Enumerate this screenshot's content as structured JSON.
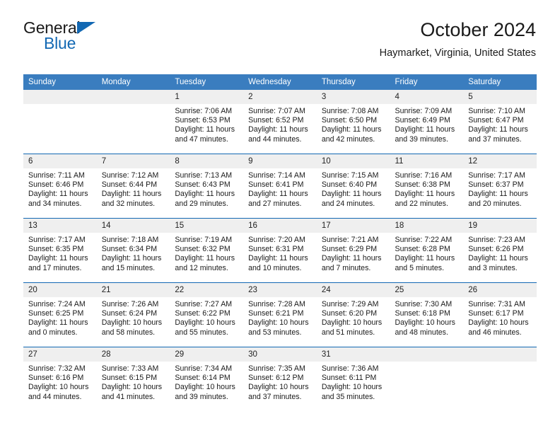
{
  "brand": {
    "name_part1": "General",
    "name_part2": "Blue",
    "triangle_icon": "triangle-icon",
    "colors": {
      "blue": "#1268b3",
      "header_blue": "#3a7dbf",
      "daynum_band": "#efefef"
    }
  },
  "header": {
    "title": "October 2024",
    "subtitle": "Haymarket, Virginia, United States"
  },
  "weekdays": [
    "Sunday",
    "Monday",
    "Tuesday",
    "Wednesday",
    "Thursday",
    "Friday",
    "Saturday"
  ],
  "labels": {
    "sunrise_prefix": "Sunrise:",
    "sunset_prefix": "Sunset:",
    "daylight_prefix": "Daylight:"
  },
  "weeks": [
    [
      {
        "day": "",
        "empty": true
      },
      {
        "day": "",
        "empty": true
      },
      {
        "day": "1",
        "sunrise": "Sunrise: 7:06 AM",
        "sunset": "Sunset: 6:53 PM",
        "daylight_line1": "Daylight: 11 hours",
        "daylight_line2": "and 47 minutes."
      },
      {
        "day": "2",
        "sunrise": "Sunrise: 7:07 AM",
        "sunset": "Sunset: 6:52 PM",
        "daylight_line1": "Daylight: 11 hours",
        "daylight_line2": "and 44 minutes."
      },
      {
        "day": "3",
        "sunrise": "Sunrise: 7:08 AM",
        "sunset": "Sunset: 6:50 PM",
        "daylight_line1": "Daylight: 11 hours",
        "daylight_line2": "and 42 minutes."
      },
      {
        "day": "4",
        "sunrise": "Sunrise: 7:09 AM",
        "sunset": "Sunset: 6:49 PM",
        "daylight_line1": "Daylight: 11 hours",
        "daylight_line2": "and 39 minutes."
      },
      {
        "day": "5",
        "sunrise": "Sunrise: 7:10 AM",
        "sunset": "Sunset: 6:47 PM",
        "daylight_line1": "Daylight: 11 hours",
        "daylight_line2": "and 37 minutes."
      }
    ],
    [
      {
        "day": "6",
        "sunrise": "Sunrise: 7:11 AM",
        "sunset": "Sunset: 6:46 PM",
        "daylight_line1": "Daylight: 11 hours",
        "daylight_line2": "and 34 minutes."
      },
      {
        "day": "7",
        "sunrise": "Sunrise: 7:12 AM",
        "sunset": "Sunset: 6:44 PM",
        "daylight_line1": "Daylight: 11 hours",
        "daylight_line2": "and 32 minutes."
      },
      {
        "day": "8",
        "sunrise": "Sunrise: 7:13 AM",
        "sunset": "Sunset: 6:43 PM",
        "daylight_line1": "Daylight: 11 hours",
        "daylight_line2": "and 29 minutes."
      },
      {
        "day": "9",
        "sunrise": "Sunrise: 7:14 AM",
        "sunset": "Sunset: 6:41 PM",
        "daylight_line1": "Daylight: 11 hours",
        "daylight_line2": "and 27 minutes."
      },
      {
        "day": "10",
        "sunrise": "Sunrise: 7:15 AM",
        "sunset": "Sunset: 6:40 PM",
        "daylight_line1": "Daylight: 11 hours",
        "daylight_line2": "and 24 minutes."
      },
      {
        "day": "11",
        "sunrise": "Sunrise: 7:16 AM",
        "sunset": "Sunset: 6:38 PM",
        "daylight_line1": "Daylight: 11 hours",
        "daylight_line2": "and 22 minutes."
      },
      {
        "day": "12",
        "sunrise": "Sunrise: 7:17 AM",
        "sunset": "Sunset: 6:37 PM",
        "daylight_line1": "Daylight: 11 hours",
        "daylight_line2": "and 20 minutes."
      }
    ],
    [
      {
        "day": "13",
        "sunrise": "Sunrise: 7:17 AM",
        "sunset": "Sunset: 6:35 PM",
        "daylight_line1": "Daylight: 11 hours",
        "daylight_line2": "and 17 minutes."
      },
      {
        "day": "14",
        "sunrise": "Sunrise: 7:18 AM",
        "sunset": "Sunset: 6:34 PM",
        "daylight_line1": "Daylight: 11 hours",
        "daylight_line2": "and 15 minutes."
      },
      {
        "day": "15",
        "sunrise": "Sunrise: 7:19 AM",
        "sunset": "Sunset: 6:32 PM",
        "daylight_line1": "Daylight: 11 hours",
        "daylight_line2": "and 12 minutes."
      },
      {
        "day": "16",
        "sunrise": "Sunrise: 7:20 AM",
        "sunset": "Sunset: 6:31 PM",
        "daylight_line1": "Daylight: 11 hours",
        "daylight_line2": "and 10 minutes."
      },
      {
        "day": "17",
        "sunrise": "Sunrise: 7:21 AM",
        "sunset": "Sunset: 6:29 PM",
        "daylight_line1": "Daylight: 11 hours",
        "daylight_line2": "and 7 minutes."
      },
      {
        "day": "18",
        "sunrise": "Sunrise: 7:22 AM",
        "sunset": "Sunset: 6:28 PM",
        "daylight_line1": "Daylight: 11 hours",
        "daylight_line2": "and 5 minutes."
      },
      {
        "day": "19",
        "sunrise": "Sunrise: 7:23 AM",
        "sunset": "Sunset: 6:26 PM",
        "daylight_line1": "Daylight: 11 hours",
        "daylight_line2": "and 3 minutes."
      }
    ],
    [
      {
        "day": "20",
        "sunrise": "Sunrise: 7:24 AM",
        "sunset": "Sunset: 6:25 PM",
        "daylight_line1": "Daylight: 11 hours",
        "daylight_line2": "and 0 minutes."
      },
      {
        "day": "21",
        "sunrise": "Sunrise: 7:26 AM",
        "sunset": "Sunset: 6:24 PM",
        "daylight_line1": "Daylight: 10 hours",
        "daylight_line2": "and 58 minutes."
      },
      {
        "day": "22",
        "sunrise": "Sunrise: 7:27 AM",
        "sunset": "Sunset: 6:22 PM",
        "daylight_line1": "Daylight: 10 hours",
        "daylight_line2": "and 55 minutes."
      },
      {
        "day": "23",
        "sunrise": "Sunrise: 7:28 AM",
        "sunset": "Sunset: 6:21 PM",
        "daylight_line1": "Daylight: 10 hours",
        "daylight_line2": "and 53 minutes."
      },
      {
        "day": "24",
        "sunrise": "Sunrise: 7:29 AM",
        "sunset": "Sunset: 6:20 PM",
        "daylight_line1": "Daylight: 10 hours",
        "daylight_line2": "and 51 minutes."
      },
      {
        "day": "25",
        "sunrise": "Sunrise: 7:30 AM",
        "sunset": "Sunset: 6:18 PM",
        "daylight_line1": "Daylight: 10 hours",
        "daylight_line2": "and 48 minutes."
      },
      {
        "day": "26",
        "sunrise": "Sunrise: 7:31 AM",
        "sunset": "Sunset: 6:17 PM",
        "daylight_line1": "Daylight: 10 hours",
        "daylight_line2": "and 46 minutes."
      }
    ],
    [
      {
        "day": "27",
        "sunrise": "Sunrise: 7:32 AM",
        "sunset": "Sunset: 6:16 PM",
        "daylight_line1": "Daylight: 10 hours",
        "daylight_line2": "and 44 minutes."
      },
      {
        "day": "28",
        "sunrise": "Sunrise: 7:33 AM",
        "sunset": "Sunset: 6:15 PM",
        "daylight_line1": "Daylight: 10 hours",
        "daylight_line2": "and 41 minutes."
      },
      {
        "day": "29",
        "sunrise": "Sunrise: 7:34 AM",
        "sunset": "Sunset: 6:14 PM",
        "daylight_line1": "Daylight: 10 hours",
        "daylight_line2": "and 39 minutes."
      },
      {
        "day": "30",
        "sunrise": "Sunrise: 7:35 AM",
        "sunset": "Sunset: 6:12 PM",
        "daylight_line1": "Daylight: 10 hours",
        "daylight_line2": "and 37 minutes."
      },
      {
        "day": "31",
        "sunrise": "Sunrise: 7:36 AM",
        "sunset": "Sunset: 6:11 PM",
        "daylight_line1": "Daylight: 10 hours",
        "daylight_line2": "and 35 minutes."
      },
      {
        "day": "",
        "empty": true
      },
      {
        "day": "",
        "empty": true
      }
    ]
  ]
}
